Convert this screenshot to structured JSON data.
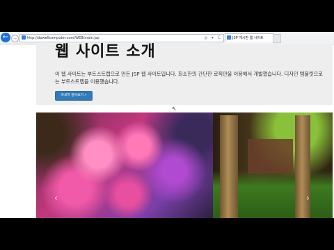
{
  "browser": {
    "url": "http://dowellcomputer.com/WEB/main.jsp",
    "tab_title": "JSP 게시판 웹 사이트",
    "address_tools": "ρ ▾ C"
  },
  "jumbotron": {
    "title": "웹 사이트 소개",
    "description": "이 웹 사이트는 부트스트랩으로 만든 JSP 웹 사이트입니다. 최소한의 간단한 로직만을 이용해서 개발했습니다. 디자인 템플릿으로는 부트스트랩을 이용했습니다.",
    "button_label": "자세히 알아보기 »"
  },
  "carousel": {
    "prev_icon": "‹",
    "next_icon": "›",
    "slides": [
      "cherry-blossom-photo",
      "garden-pillars-photo"
    ]
  },
  "colors": {
    "accent": "#337ab7",
    "jumbotron_bg": "#eeeeee",
    "browser_back": "#1e6fd9"
  }
}
